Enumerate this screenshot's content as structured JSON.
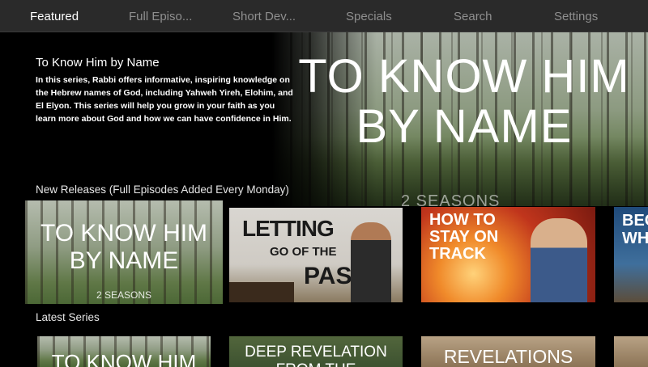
{
  "nav": {
    "items": [
      {
        "label": "Featured",
        "active": true
      },
      {
        "label": "Full Episo...",
        "active": false
      },
      {
        "label": "Short Dev...",
        "active": false
      },
      {
        "label": "Specials",
        "active": false
      },
      {
        "label": "Search",
        "active": false
      },
      {
        "label": "Settings",
        "active": false
      }
    ]
  },
  "hero": {
    "title": "To Know Him by Name",
    "description": "In this series, Rabbi offers informative, inspiring knowledge on the Hebrew names of God, including Yahweh Yireh, Elohim, and El Elyon. This series will help you grow in your faith as you learn more about God and how we can have confidence in Him.",
    "art_title": "TO KNOW HIM BY NAME",
    "art_seasons": "2 SEASONS"
  },
  "rows": [
    {
      "label": "New Releases (Full Episodes Added Every Monday)",
      "tiles": [
        {
          "title": "TO KNOW HIM BY NAME",
          "subtitle": "2 SEASONS"
        },
        {
          "title_top": "LETTING",
          "title_mid": "GO OF THE",
          "title_bottom": "PAST"
        },
        {
          "title": "HOW TO STAY ON TRACK"
        },
        {
          "title": "BEC WHO"
        }
      ]
    },
    {
      "label": "Latest Series",
      "tiles": [
        {
          "title": "TO KNOW HIM"
        },
        {
          "title": "DEEP REVELATION FROM THE"
        },
        {
          "title": "REVELATIONS"
        }
      ]
    }
  ],
  "colors": {
    "nav_bg": "#2a2a2a",
    "nav_inactive": "#8f8f8f",
    "nav_active": "#ffffff",
    "background": "#000000"
  }
}
